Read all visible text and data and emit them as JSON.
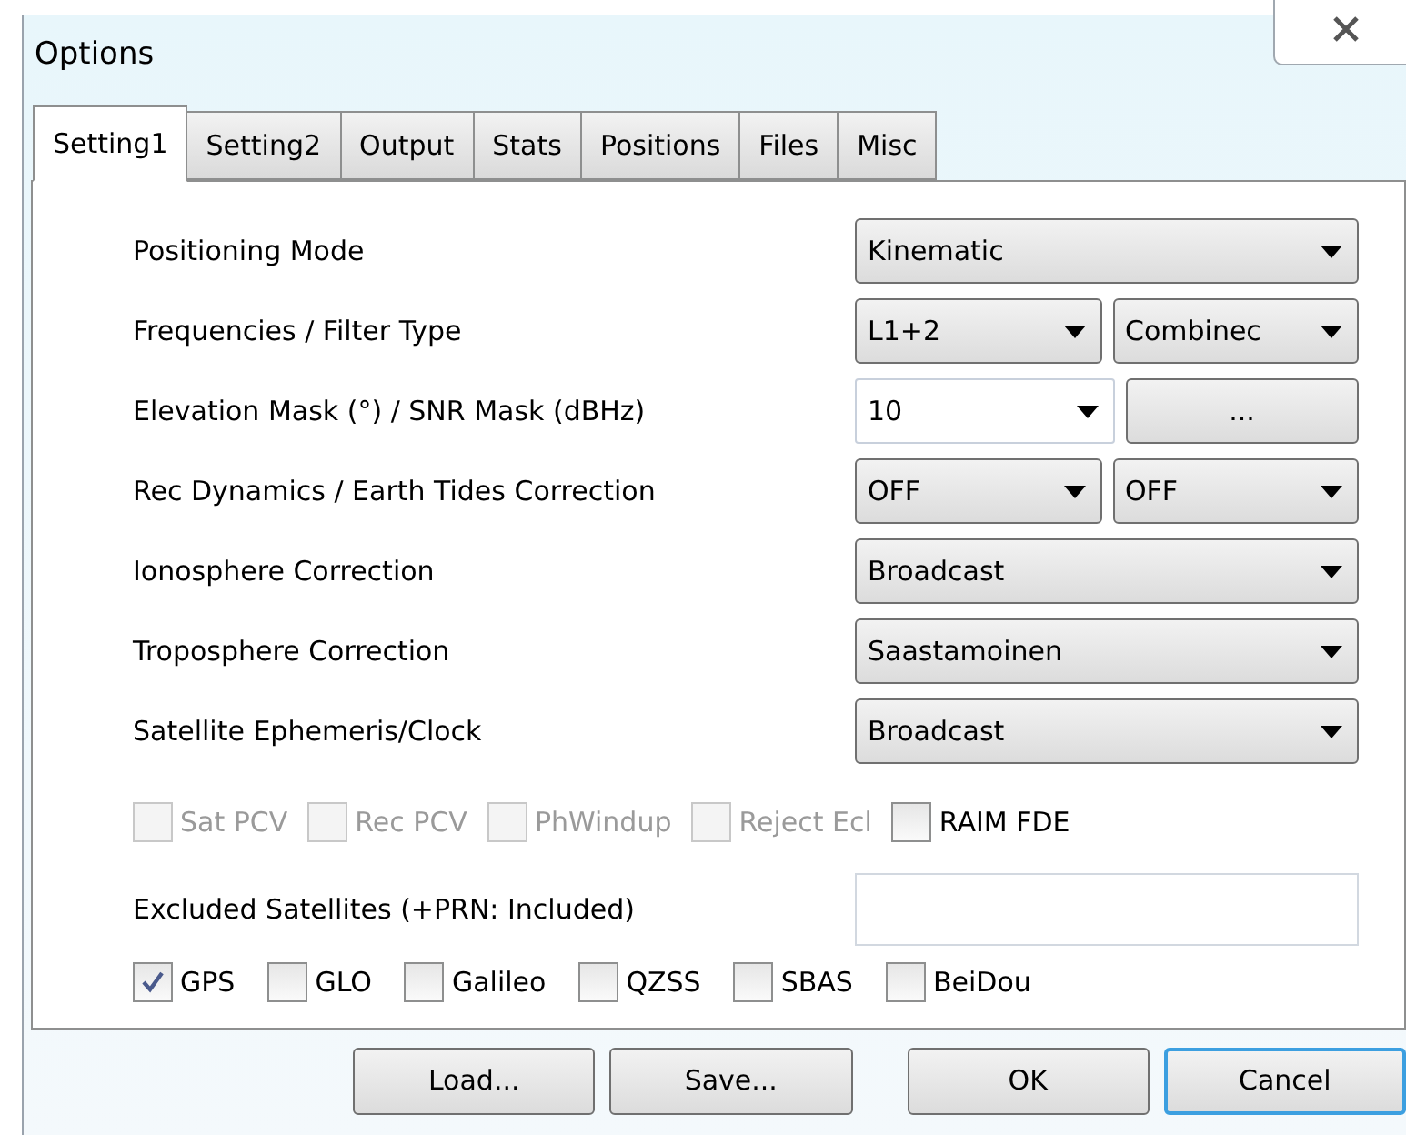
{
  "window": {
    "title": "Options"
  },
  "tabs": [
    {
      "label": "Setting1",
      "selected": true
    },
    {
      "label": "Setting2",
      "selected": false
    },
    {
      "label": "Output",
      "selected": false
    },
    {
      "label": "Stats",
      "selected": false
    },
    {
      "label": "Positions",
      "selected": false
    },
    {
      "label": "Files",
      "selected": false
    },
    {
      "label": "Misc",
      "selected": false
    }
  ],
  "settings": [
    {
      "label": "Positioning Mode",
      "controls": [
        {
          "kind": "select",
          "value": "Kinematic"
        }
      ]
    },
    {
      "label": "Frequencies / Filter Type",
      "controls": [
        {
          "kind": "select",
          "value": "L1+2"
        },
        {
          "kind": "select",
          "value": "Combinec"
        }
      ]
    },
    {
      "label": "Elevation Mask (°) / SNR Mask (dBHz)",
      "controls": [
        {
          "kind": "combo",
          "value": "10"
        },
        {
          "kind": "button",
          "value": "..."
        }
      ]
    },
    {
      "label": "Rec Dynamics / Earth Tides Correction",
      "controls": [
        {
          "kind": "select",
          "value": "OFF"
        },
        {
          "kind": "select",
          "value": "OFF"
        }
      ]
    },
    {
      "label": "Ionosphere Correction",
      "controls": [
        {
          "kind": "select",
          "value": "Broadcast"
        }
      ]
    },
    {
      "label": "Troposphere Correction",
      "controls": [
        {
          "kind": "select",
          "value": "Saastamoinen"
        }
      ]
    },
    {
      "label": "Satellite Ephemeris/Clock",
      "controls": [
        {
          "kind": "select",
          "value": "Broadcast"
        }
      ]
    }
  ],
  "options": [
    {
      "label": "Sat PCV",
      "checked": false,
      "disabled": true
    },
    {
      "label": "Rec PCV",
      "checked": false,
      "disabled": true
    },
    {
      "label": "PhWindup",
      "checked": false,
      "disabled": true
    },
    {
      "label": "Reject Ecl",
      "checked": false,
      "disabled": true
    },
    {
      "label": "RAIM FDE",
      "checked": false,
      "disabled": false
    }
  ],
  "excluded_satellites": {
    "label": "Excluded Satellites (+PRN: Included)"
  },
  "systems": [
    {
      "label": "GPS",
      "checked": true
    },
    {
      "label": "GLO",
      "checked": false
    },
    {
      "label": "Galileo",
      "checked": false
    },
    {
      "label": "QZSS",
      "checked": false
    },
    {
      "label": "SBAS",
      "checked": false
    },
    {
      "label": "BeiDou",
      "checked": false
    }
  ],
  "buttons": [
    {
      "label": "Load...",
      "default": false
    },
    {
      "label": "Save...",
      "default": false
    },
    {
      "label": "OK",
      "default": false
    },
    {
      "label": "Cancel",
      "default": true
    }
  ]
}
